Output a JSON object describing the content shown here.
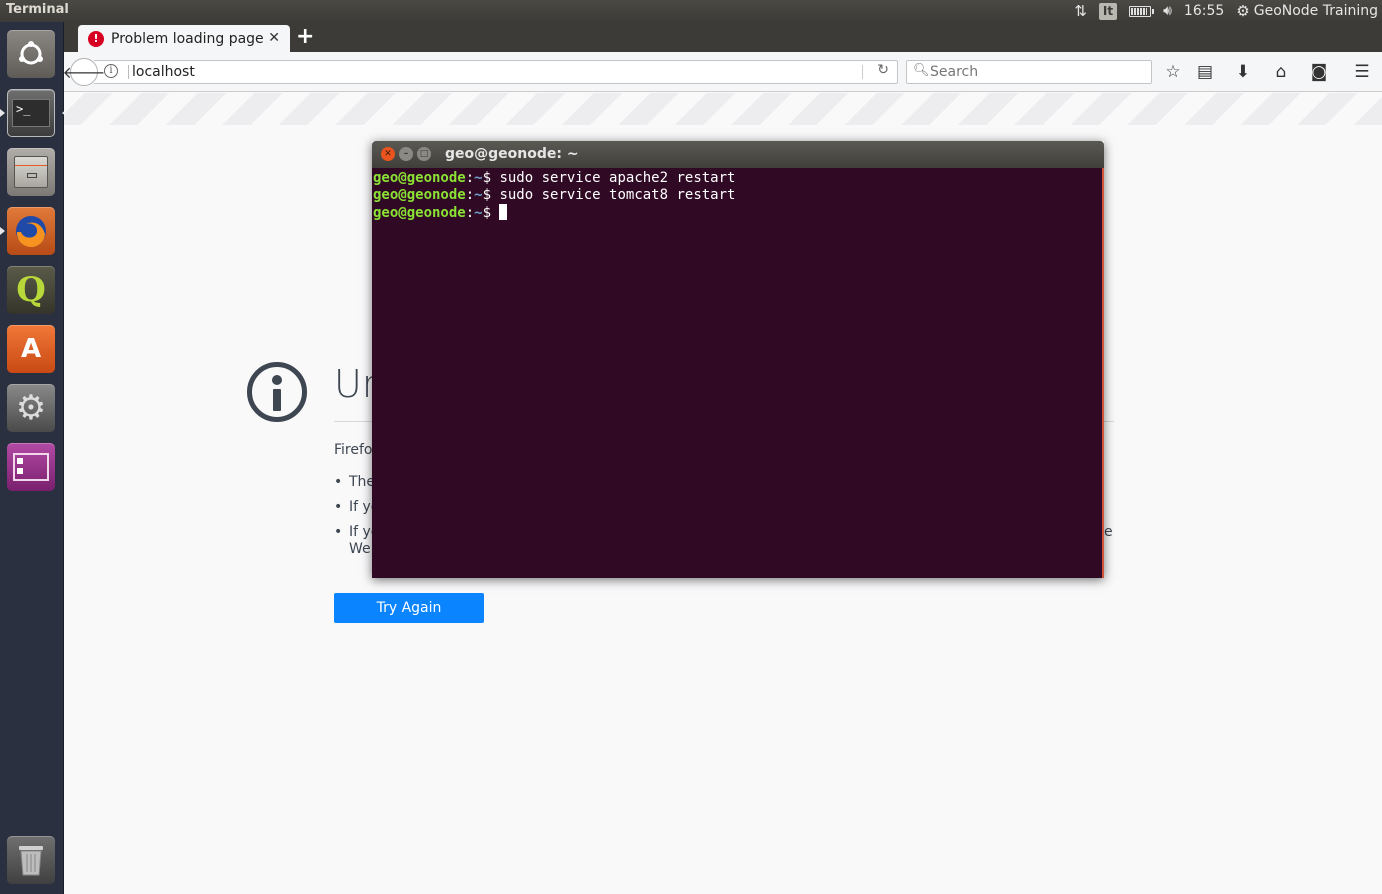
{
  "top_panel": {
    "app_title": "Terminal",
    "keyboard_layout": "It",
    "clock": "16:55",
    "user": "GeoNode Training"
  },
  "launcher": {
    "items": [
      {
        "name": "ubuntu-dash",
        "color": "#6d6a66"
      },
      {
        "name": "terminal",
        "color": "#3a3a3a"
      },
      {
        "name": "files",
        "color": "#8d8a85"
      },
      {
        "name": "firefox",
        "color": "#d85a1e"
      },
      {
        "name": "qgis",
        "color": "#4a4a3a"
      },
      {
        "name": "software-center",
        "color": "#e35a22"
      },
      {
        "name": "system-settings",
        "color": "#666666"
      },
      {
        "name": "workspace-switcher",
        "color": "#8a2a7c"
      },
      {
        "name": "trash",
        "color": "#5a5a5a"
      }
    ]
  },
  "browser": {
    "tab_title": "Problem loading page",
    "url": "localhost",
    "search_placeholder": "Search",
    "error": {
      "title": "Un",
      "intro": "Firefo",
      "bullets": [
        "The",
        "If yo",
        "If yo"
      ],
      "bullet3_tail": "e",
      "bullet3_line2": "We",
      "button": "Try Again"
    }
  },
  "terminal": {
    "title": "geo@geonode: ~",
    "lines": [
      {
        "user": "geo@geonode",
        "path": "~",
        "dollar": "$ ",
        "cmd": "sudo service apache2 restart"
      },
      {
        "user": "geo@geonode",
        "path": "~",
        "dollar": "$ ",
        "cmd": "sudo service tomcat8 restart"
      },
      {
        "user": "geo@geonode",
        "path": "~",
        "dollar": "$ ",
        "cmd": ""
      }
    ]
  },
  "colors": {
    "terminal_bg": "#300a24",
    "prompt_user": "#8ae234",
    "prompt_path": "#729fcf",
    "try_again_button": "#0a84ff",
    "tab_error": "#d70022"
  }
}
